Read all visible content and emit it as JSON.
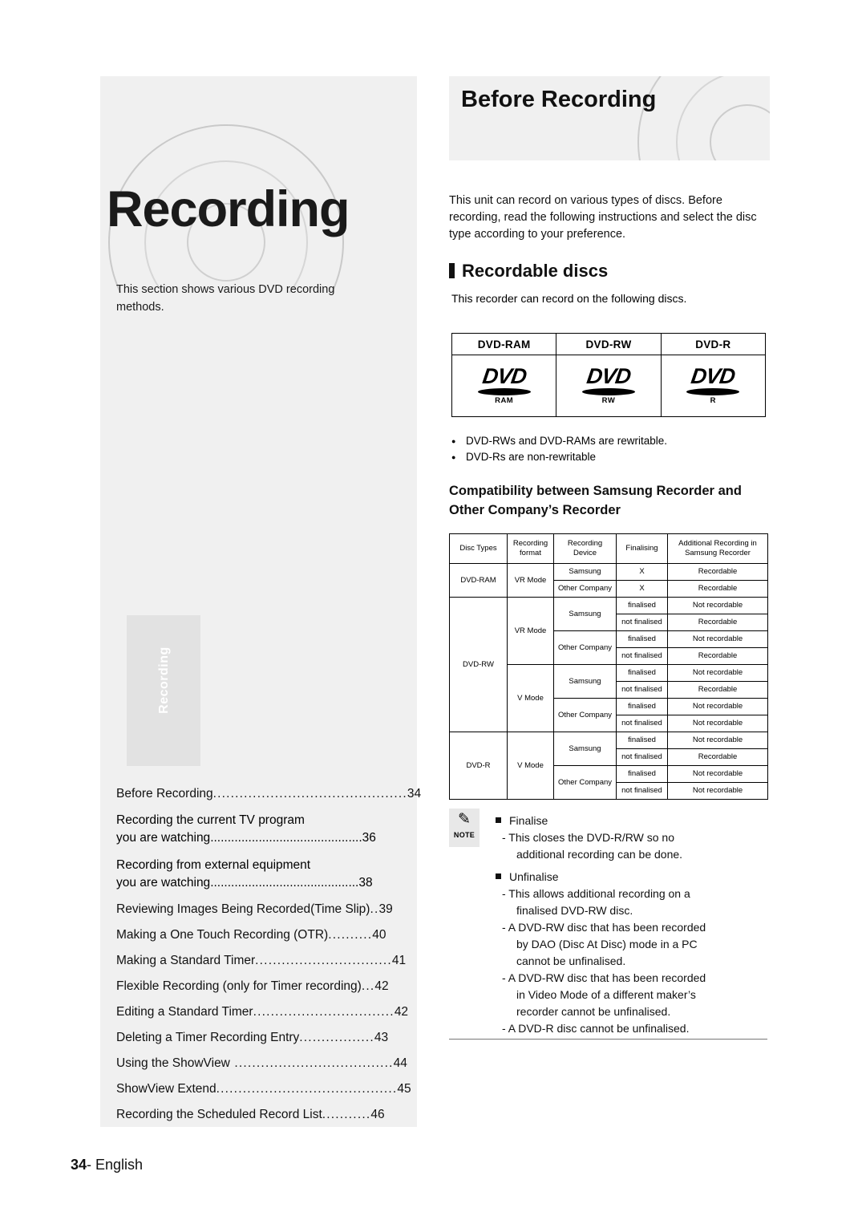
{
  "left": {
    "chapter_title": "Recording",
    "intro": "This section shows various DVD recording methods.",
    "side_tab": "Recording",
    "toc": [
      {
        "text": "Before Recording",
        "dots": "............................................",
        "page": "34"
      },
      {
        "line1": "Recording the current TV program",
        "text": "you are watching",
        "dots": "............................................",
        "page": "36"
      },
      {
        "line1": "Recording from external equipment",
        "text": "you are watching",
        "dots": "...........................................",
        "page": "38"
      },
      {
        "text": "Reviewing Images Being Recorded(Time Slip)",
        "dots": "..",
        "page": "39"
      },
      {
        "text": "Making a One Touch Recording (OTR)",
        "dots": "..........",
        "page": "40"
      },
      {
        "text": "Making a Standard Timer",
        "dots": "...............................",
        "page": "41"
      },
      {
        "text": "Flexible Recording (only for Timer recording)",
        "dots": "...",
        "page": "42"
      },
      {
        "text": "Editing a Standard Timer",
        "dots": "................................",
        "page": "42"
      },
      {
        "text": "Deleting a Timer Recording Entry",
        "dots": ".................",
        "page": "43"
      },
      {
        "text": "Using the ShowView",
        "dots": " ....................................",
        "page": "44"
      },
      {
        "text": "ShowView Extend",
        "dots": ".........................................",
        "page": "45"
      },
      {
        "text": "Recording the Scheduled Record List",
        "dots": "...........",
        "page": "46"
      }
    ],
    "footer_page": "34",
    "footer_dash": "- ",
    "footer_lang": "English"
  },
  "right": {
    "heading": "Before Recording",
    "intro": "This unit can record on various types of discs. Before recording, read the following instructions and select the disc type according to your preference.",
    "section_title": "Recordable discs",
    "section_intro": "This recorder can record on the following discs.",
    "disc_table": {
      "headers": [
        "DVD-RAM",
        "DVD-RW",
        "DVD-R"
      ],
      "logos": [
        {
          "top": "DVD",
          "bottom": "RAM"
        },
        {
          "top": "DVD",
          "bottom": "RW"
        },
        {
          "top": "DVD",
          "bottom": "R"
        }
      ]
    },
    "bullets": [
      "DVD-RWs and DVD-RAMs are rewritable.",
      "DVD-Rs are non-rewritable"
    ],
    "compat_heading_line1": "Compatibility between Samsung Recorder and",
    "compat_heading_line2": "Other Company’s Recorder",
    "compat_table": {
      "headers": [
        "Disc Types",
        "Recording format",
        "Recording Device",
        "Finalising",
        "Additional Recording in Samsung Recorder"
      ],
      "header_parts": [
        [
          "Disc Types"
        ],
        [
          "Recording",
          "format"
        ],
        [
          "Recording",
          "Device"
        ],
        [
          "Finalising"
        ],
        [
          "Additional Recording in",
          "Samsung Recorder"
        ]
      ],
      "rows": [
        {
          "disc": "DVD-RAM",
          "format": "VR Mode",
          "device": "Samsung",
          "finalising": "X",
          "additional": "Recordable"
        },
        {
          "device": "Other Company",
          "finalising": "X",
          "additional": "Recordable"
        },
        {
          "disc": "DVD-RW",
          "format": "VR Mode",
          "device": "Samsung",
          "finalising": "finalised",
          "additional": "Not recordable"
        },
        {
          "finalising": "not finalised",
          "additional": "Recordable"
        },
        {
          "device": "Other Company",
          "finalising": "finalised",
          "additional": "Not recordable"
        },
        {
          "finalising": "not finalised",
          "additional": "Recordable"
        },
        {
          "format": "V Mode",
          "device": "Samsung",
          "finalising": "finalised",
          "additional": "Not recordable"
        },
        {
          "finalising": "not finalised",
          "additional": "Recordable"
        },
        {
          "device": "Other Company",
          "finalising": "finalised",
          "additional": "Not recordable"
        },
        {
          "finalising": "not finalised",
          "additional": "Not recordable"
        },
        {
          "disc": "DVD-R",
          "format": "V Mode",
          "device": "Samsung",
          "finalising": "finalised",
          "additional": "Not recordable"
        },
        {
          "finalising": "not finalised",
          "additional": "Recordable"
        },
        {
          "device": "Other Company",
          "finalising": "finalised",
          "additional": "Not recordable"
        },
        {
          "finalising": "not finalised",
          "additional": "Not recordable"
        }
      ]
    },
    "note": {
      "label": "NOTE",
      "icon": "pencil-icon",
      "item1": "Finalise",
      "item1_sub1": "- This closes the DVD-R/RW so no",
      "item1_sub2": "additional recording can be done.",
      "item2": "Unfinalise",
      "item2_sub1": "- This allows additional recording on a",
      "item2_sub2": "finalised DVD-RW disc.",
      "item2_sub3": "- A DVD-RW disc that has been recorded",
      "item2_sub4": "by DAO (Disc At Disc) mode in a PC",
      "item2_sub5": "cannot be unfinalised.",
      "item2_sub6": "- A DVD-RW disc that has been recorded",
      "item2_sub7": "in Video Mode of a different maker’s",
      "item2_sub8": "recorder cannot be unfinalised.",
      "item2_sub9": "- A DVD-R disc cannot be unfinalised."
    }
  }
}
